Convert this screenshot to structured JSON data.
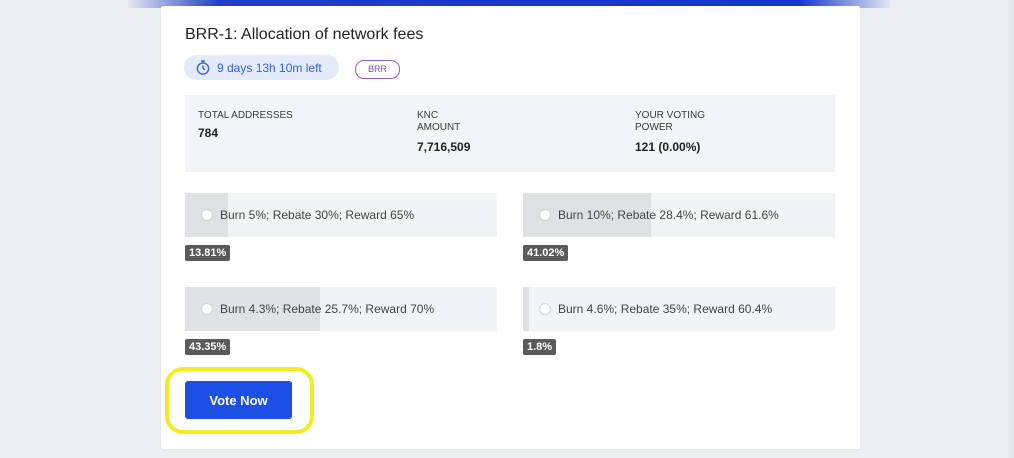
{
  "proposal": {
    "title": "BRR-1: Allocation of network fees",
    "time_left": "9 days 13h 10m left",
    "tag": "BRR"
  },
  "stats": {
    "total_addresses_label": "TOTAL ADDRESSES",
    "total_addresses_value": "784",
    "knc_amount_label_line1": "KNC",
    "knc_amount_label_line2": "AMOUNT",
    "knc_amount_value": "7,716,509",
    "voting_power_label_line1": "YOUR VOTING",
    "voting_power_label_line2": "POWER",
    "voting_power_value": "121 (0.00%)"
  },
  "options": [
    {
      "label": "Burn 5%; Rebate 30%; Reward 65%",
      "percent": "13.81%",
      "share": 13.81
    },
    {
      "label": "Burn 10%; Rebate 28.4%; Reward 61.6%",
      "percent": "41.02%",
      "share": 41.02
    },
    {
      "label": "Burn 4.3%; Rebate 25.7%; Reward 70%",
      "percent": "43.35%",
      "share": 43.35
    },
    {
      "label": "Burn 4.6%; Rebate 35%; Reward 60.4%",
      "percent": "1.8%",
      "share": 1.8
    }
  ],
  "vote_button_label": "Vote Now",
  "icons": {
    "timer": "stopwatch-icon"
  },
  "colors": {
    "accent": "#1c4fe6",
    "tag_border": "#8b62c8",
    "highlight": "#f2ec20"
  }
}
